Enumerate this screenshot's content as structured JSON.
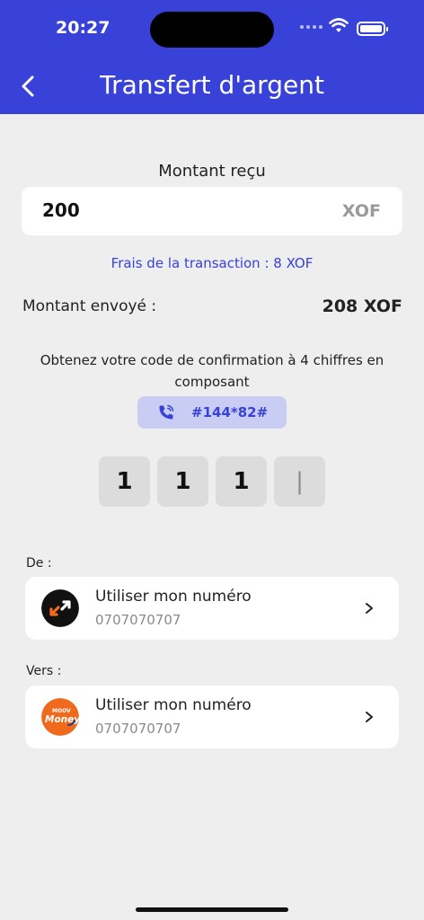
{
  "status_bar": {
    "time": "20:27"
  },
  "header": {
    "title": "Transfert d'argent"
  },
  "amount": {
    "label": "Montant reçu",
    "value": "200",
    "currency": "XOF"
  },
  "fees": "Frais de la transaction : 8 XOF",
  "sent": {
    "label": "Montant envoyé :",
    "value": "208 XOF"
  },
  "confirmation": {
    "text": "Obtenez votre code de confirmation à 4 chiffres en composant",
    "ussd_code": "#144*82#",
    "digits": [
      "1",
      "1",
      "1",
      "|"
    ]
  },
  "from": {
    "label": "De :",
    "title": "Utiliser mon numéro",
    "number": "0707070707",
    "icon": "orange-money-logo"
  },
  "to": {
    "label": "Vers :",
    "title": "Utiliser mon numéro",
    "number": "0707070707",
    "icon": "moov-money-logo",
    "logo_text_top": "MOOV",
    "logo_text_main": "Money"
  },
  "colors": {
    "primary": "#3842d8",
    "background": "#eeeeee",
    "chip": "#c9cdf3",
    "moov_orange": "#f06a1d"
  }
}
